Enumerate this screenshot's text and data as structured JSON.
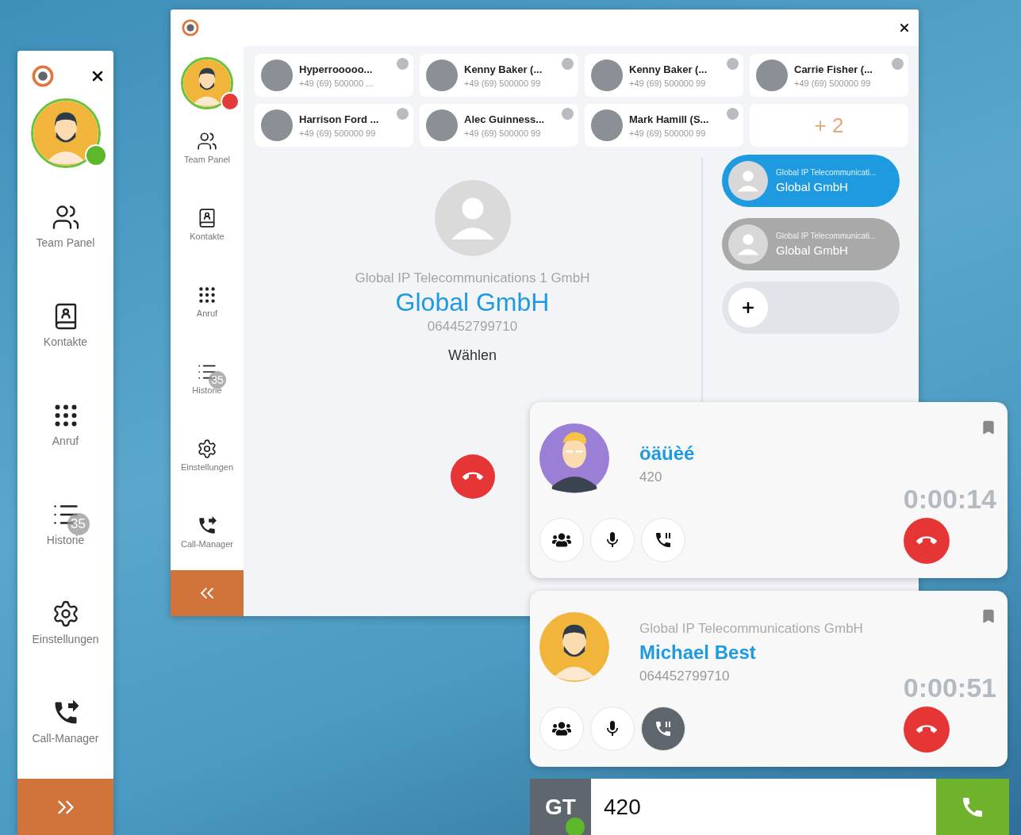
{
  "side_panel": {
    "online": true,
    "nav": [
      {
        "kind": "team",
        "label": "Team Panel"
      },
      {
        "kind": "contacts",
        "label": "Kontakte"
      },
      {
        "kind": "dialpad",
        "label": "Anruf"
      },
      {
        "kind": "history",
        "label": "Historie",
        "badge": "35"
      },
      {
        "kind": "settings",
        "label": "Einstellungen"
      },
      {
        "kind": "callmanager",
        "label": "Call-Manager"
      }
    ]
  },
  "main_window": {
    "online": false,
    "nav": [
      {
        "kind": "team",
        "label": "Team Panel"
      },
      {
        "kind": "contacts",
        "label": "Kontakte"
      },
      {
        "kind": "dialpad",
        "label": "Anruf"
      },
      {
        "kind": "history",
        "label": "Historie",
        "badge": "35"
      },
      {
        "kind": "settings",
        "label": "Einstellungen"
      },
      {
        "kind": "callmanager",
        "label": "Call-Manager"
      }
    ],
    "contacts": [
      {
        "name": "Hyperrooooo...",
        "number": "+49 (69) 500000 ...",
        "online": false
      },
      {
        "name": "Kenny Baker (...",
        "number": "+49 (69) 500000 99",
        "online": false
      },
      {
        "name": "Kenny Baker (...",
        "number": "+49 (69) 500000 99",
        "online": false
      },
      {
        "name": "Carrie Fisher (...",
        "number": "+49 (69) 500000 99",
        "online": false
      },
      {
        "name": "Harrison Ford ...",
        "number": "+49 (69) 500000 99",
        "online": false
      },
      {
        "name": "Alec Guinness...",
        "number": "+49 (69) 500000 99",
        "online": false
      },
      {
        "name": "Mark Hamill (S...",
        "number": "+49 (69) 500000 99",
        "online": false
      }
    ],
    "more_contacts": "+ 2",
    "current": {
      "company": "Global IP Telecommunications 1 GmbH",
      "name": "Global GmbH",
      "number": "064452799710",
      "action": "Wählen"
    },
    "call_list": [
      {
        "company": "Global IP Telecommunicati...",
        "name": "Global GmbH",
        "selected": true
      },
      {
        "company": "Global IP Telecommunicati...",
        "name": "Global GmbH",
        "selected": false
      }
    ]
  },
  "calls": [
    {
      "name": "öäüèé",
      "number": "420",
      "duration": "0:00:14",
      "on_hold": false
    },
    {
      "company": "Global IP Telecommunications GmbH",
      "name": "Michael Best",
      "number": "064452799710",
      "duration": "0:00:51",
      "on_hold": true
    }
  ],
  "dial_bar": {
    "initials": "GT",
    "online": true,
    "value": "420"
  }
}
